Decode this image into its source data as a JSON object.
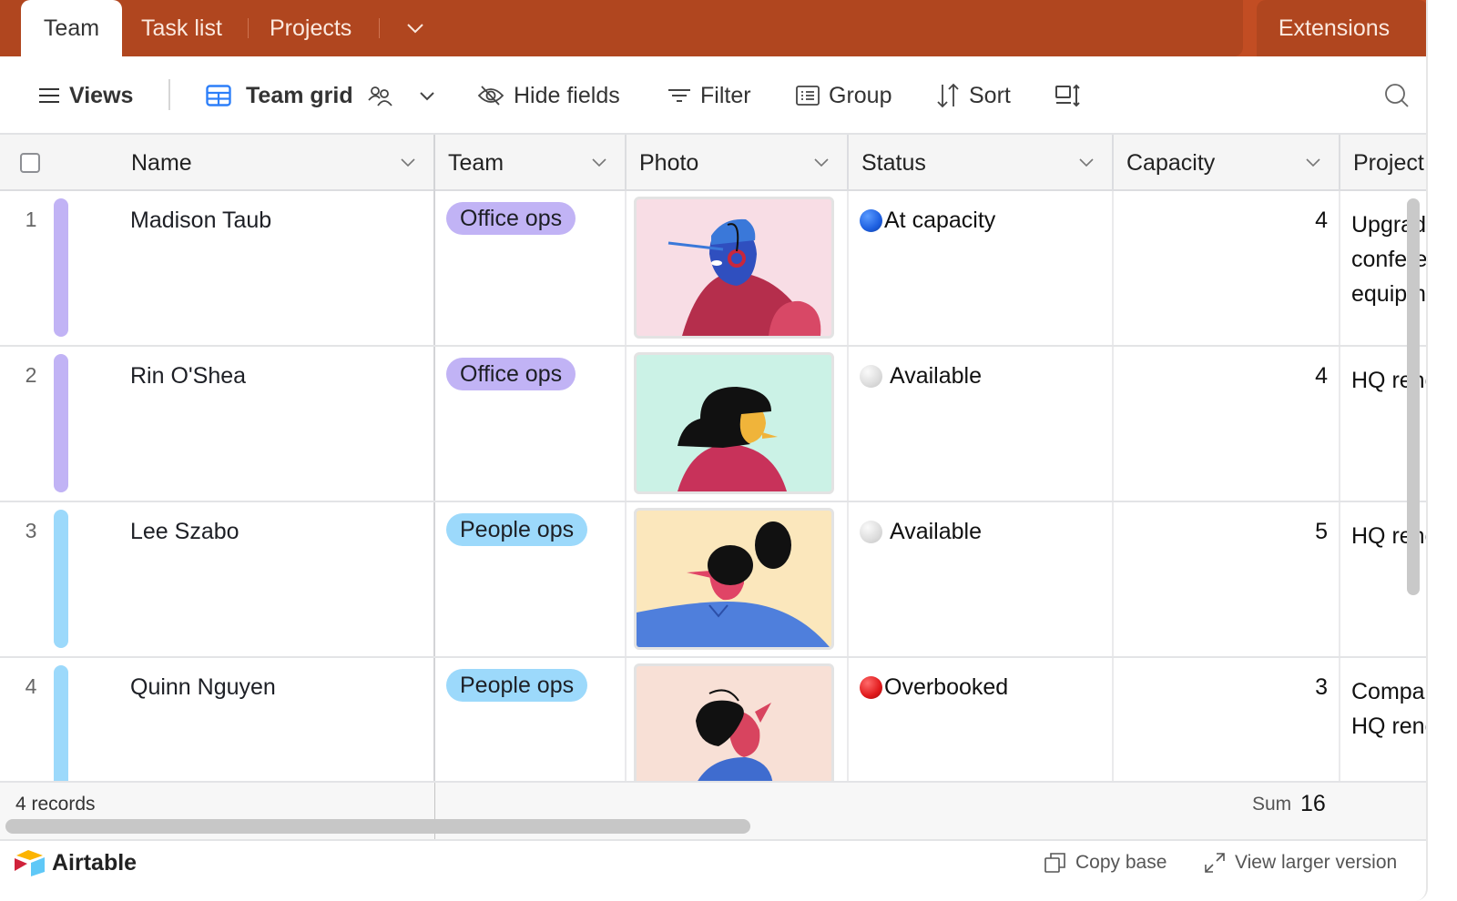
{
  "tabs": {
    "items": [
      {
        "label": "Team",
        "active": true
      },
      {
        "label": "Task list",
        "active": false
      },
      {
        "label": "Projects",
        "active": false
      }
    ],
    "more_icon": "chevron-down-icon",
    "extensions_label": "Extensions"
  },
  "colors": {
    "brand_bar": "#b0461f",
    "office_ops": "#c1b3f5",
    "people_ops": "#9cd9fb",
    "at_capacity": "#1d5fe0",
    "available": "#e0e0e0",
    "overbooked": "#e0191b"
  },
  "toolbar": {
    "views_label": "Views",
    "view_name": "Team grid",
    "hide_fields_label": "Hide fields",
    "filter_label": "Filter",
    "group_label": "Group",
    "sort_label": "Sort"
  },
  "columns": [
    {
      "label": "Name"
    },
    {
      "label": "Team"
    },
    {
      "label": "Photo"
    },
    {
      "label": "Status"
    },
    {
      "label": "Capacity"
    },
    {
      "label": "Project"
    }
  ],
  "rows": [
    {
      "num": "1",
      "name": "Madison Taub",
      "team": "Office ops",
      "photo": "illustration-person-blue-cap-headphones",
      "status": "At capacity",
      "capacity": "4",
      "project_lines": [
        "Upgrade",
        "conference",
        "equipment"
      ]
    },
    {
      "num": "2",
      "name": "Rin O'Shea",
      "team": "Office ops",
      "photo": "illustration-person-black-hair-yellow-face",
      "status": "Available",
      "capacity": "4",
      "project_lines": [
        "HQ renovation"
      ]
    },
    {
      "num": "3",
      "name": "Lee Szabo",
      "team": "People ops",
      "photo": "illustration-person-bun-blue-shirt",
      "status": "Available",
      "capacity": "5",
      "project_lines": [
        "HQ renovation"
      ]
    },
    {
      "num": "4",
      "name": "Quinn Nguyen",
      "team": "People ops",
      "photo": "illustration-person-looking-up",
      "status": "Overbooked",
      "capacity": "3",
      "project_lines": [
        "Company",
        "HQ renovation"
      ]
    }
  ],
  "summary": {
    "records": "4 records",
    "sum_label": "Sum",
    "sum_value": "16"
  },
  "footer": {
    "brand": "Airtable",
    "copy_base": "Copy base",
    "view_larger": "View larger version"
  }
}
